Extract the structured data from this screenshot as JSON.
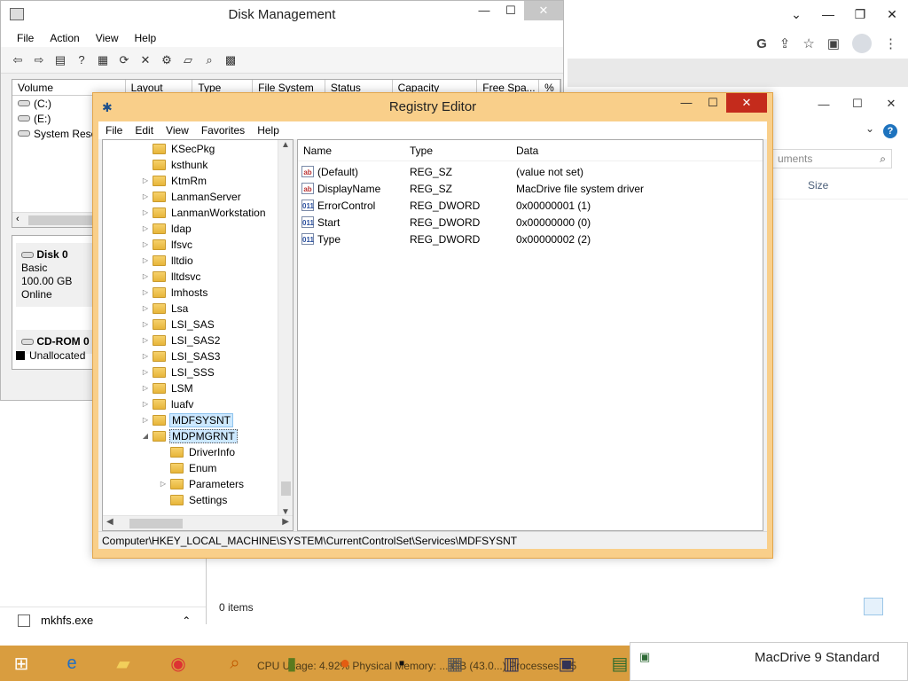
{
  "chrome": {
    "window_buttons": [
      "⌄",
      "—",
      "❐",
      "✕"
    ],
    "toolbar_icons": [
      "google-icon",
      "share-icon",
      "star-icon",
      "sidebar-icon",
      "profile-icon",
      "more-icon"
    ]
  },
  "explorer": {
    "search_placeholder": "uments",
    "size_header": "Size",
    "status": "0 items"
  },
  "disk_mgmt": {
    "title": "Disk Management",
    "menu": [
      "File",
      "Action",
      "View",
      "Help"
    ],
    "columns": [
      "Volume",
      "Layout",
      "Type",
      "File System",
      "Status",
      "Capacity",
      "Free Spa...",
      "%"
    ],
    "volumes": [
      "(C:)",
      "(E:)",
      "System Rese"
    ],
    "disk0": {
      "name": "Disk 0",
      "type": "Basic",
      "size": "100.00 GB",
      "status": "Online"
    },
    "cdrom": {
      "name": "CD-ROM 0"
    },
    "unallocated": "Unallocated"
  },
  "regedit": {
    "title": "Registry Editor",
    "menu": [
      "File",
      "Edit",
      "View",
      "Favorites",
      "Help"
    ],
    "tree": [
      {
        "label": "KSecPkg",
        "indent": 0,
        "exp": ""
      },
      {
        "label": "ksthunk",
        "indent": 0,
        "exp": ""
      },
      {
        "label": "KtmRm",
        "indent": 0,
        "exp": "▷"
      },
      {
        "label": "LanmanServer",
        "indent": 0,
        "exp": "▷"
      },
      {
        "label": "LanmanWorkstation",
        "indent": 0,
        "exp": "▷"
      },
      {
        "label": "ldap",
        "indent": 0,
        "exp": "▷"
      },
      {
        "label": "lfsvc",
        "indent": 0,
        "exp": "▷"
      },
      {
        "label": "lltdio",
        "indent": 0,
        "exp": "▷"
      },
      {
        "label": "lltdsvc",
        "indent": 0,
        "exp": "▷"
      },
      {
        "label": "lmhosts",
        "indent": 0,
        "exp": "▷"
      },
      {
        "label": "Lsa",
        "indent": 0,
        "exp": "▷"
      },
      {
        "label": "LSI_SAS",
        "indent": 0,
        "exp": "▷"
      },
      {
        "label": "LSI_SAS2",
        "indent": 0,
        "exp": "▷"
      },
      {
        "label": "LSI_SAS3",
        "indent": 0,
        "exp": "▷"
      },
      {
        "label": "LSI_SSS",
        "indent": 0,
        "exp": "▷"
      },
      {
        "label": "LSM",
        "indent": 0,
        "exp": "▷"
      },
      {
        "label": "luafv",
        "indent": 0,
        "exp": "▷"
      },
      {
        "label": "MDFSYSNT",
        "indent": 0,
        "exp": "▷",
        "state": "selected"
      },
      {
        "label": "MDPMGRNT",
        "indent": 0,
        "exp": "◢",
        "state": "focused"
      },
      {
        "label": "DriverInfo",
        "indent": 1,
        "exp": ""
      },
      {
        "label": "Enum",
        "indent": 1,
        "exp": ""
      },
      {
        "label": "Parameters",
        "indent": 1,
        "exp": "▷"
      },
      {
        "label": "Settings",
        "indent": 1,
        "exp": ""
      }
    ],
    "value_columns": [
      "Name",
      "Type",
      "Data"
    ],
    "values": [
      {
        "name": "(Default)",
        "type": "REG_SZ",
        "data": "(value not set)",
        "kind": "ab"
      },
      {
        "name": "DisplayName",
        "type": "REG_SZ",
        "data": "MacDrive file system driver",
        "kind": "ab"
      },
      {
        "name": "ErrorControl",
        "type": "REG_DWORD",
        "data": "0x00000001 (1)",
        "kind": "011"
      },
      {
        "name": "Start",
        "type": "REG_DWORD",
        "data": "0x00000000 (0)",
        "kind": "011"
      },
      {
        "name": "Type",
        "type": "REG_DWORD",
        "data": "0x00000002 (2)",
        "kind": "011"
      }
    ],
    "status_path": "Computer\\HKEY_LOCAL_MACHINE\\SYSTEM\\CurrentControlSet\\Services\\MDFSYSNT",
    "window_buttons": [
      "—",
      "☐",
      "✕"
    ]
  },
  "downloads": {
    "file": "mkhfs.exe"
  },
  "taskbar": {
    "hint": "CPU Usage: 4.92%   Physical Memory: ... GB (43.0...)   Processes: 55",
    "icons": [
      "start-icon",
      "ie-icon",
      "file-explorer-icon",
      "chrome-icon",
      "search-icon",
      "task-manager-icon",
      "firefox-icon",
      "cmd-icon",
      "printer-icon",
      "network-icon",
      "monitor-icon",
      "ram-icon"
    ]
  },
  "macdrive": {
    "title": "MacDrive 9 Standard"
  },
  "colors": {
    "regedit_frame": "#f9cf8a",
    "taskbar": "#d99d3f",
    "selection": "#cce8ff",
    "close_red": "#c42b1c"
  }
}
